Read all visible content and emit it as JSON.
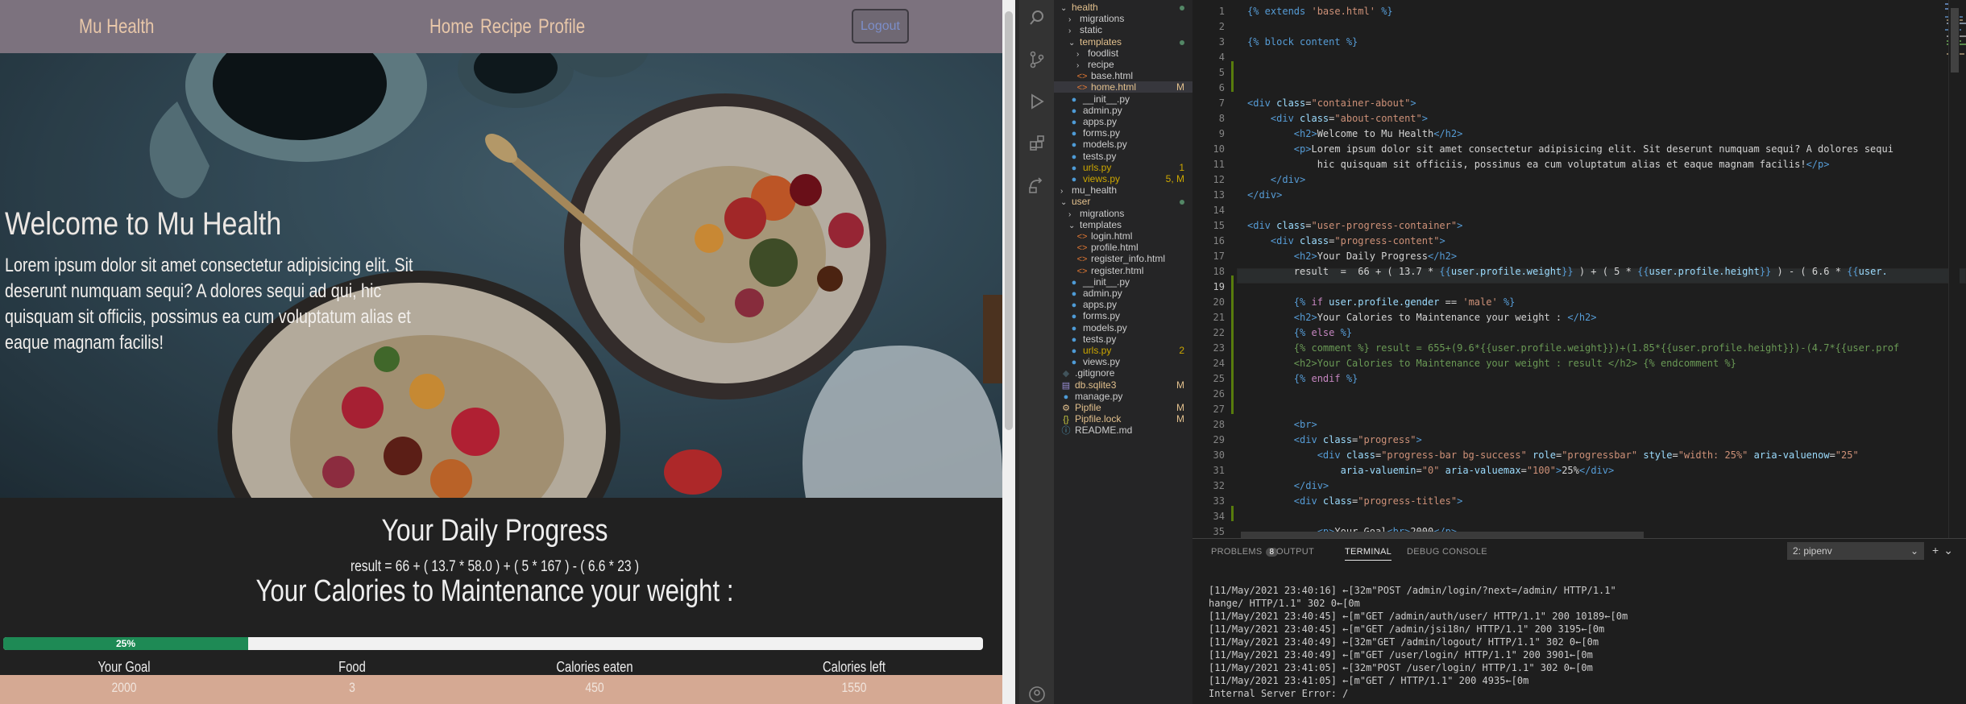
{
  "site": {
    "brand": "Mu Health",
    "nav": [
      "Home",
      "Recipe",
      "Profile"
    ],
    "nav_button": "Logout",
    "hero_title": "Welcome to Mu Health",
    "hero_text": "Lorem ipsum dolor sit amet consectetur adipisicing elit. Sit deserunt numquam sequi? A dolores sequi ad qui, hic quisquam sit officiis, possimus ea cum voluptatum alias et eaque magnam facilis!",
    "progress_title": "Your Daily Progress",
    "result_line": "result = 66 + ( 13.7 * 58.0 ) + ( 5 * 167 ) - ( 6.6 * 23 )",
    "maintenance_title": "Your Calories to Maintenance your weight :",
    "progress_label": "25%",
    "progress_value": 25,
    "columns": [
      "Your Goal",
      "Food",
      "Calories eaten",
      "Calories left"
    ],
    "values": [
      "2000",
      "3",
      "450",
      "1550"
    ]
  },
  "explorer": [
    {
      "label": "health",
      "depth": 0,
      "type": "folder-open",
      "color": "#e2c08d",
      "status": "dot"
    },
    {
      "label": "migrations",
      "depth": 1,
      "type": "folder",
      "color": "#cccccc",
      "status": ""
    },
    {
      "label": "static",
      "depth": 1,
      "type": "folder",
      "color": "#cccccc",
      "status": ""
    },
    {
      "label": "templates",
      "depth": 1,
      "type": "folder-open",
      "color": "#e2c08d",
      "status": "dot"
    },
    {
      "label": "foodlist",
      "depth": 2,
      "type": "folder",
      "color": "#cccccc",
      "status": ""
    },
    {
      "label": "recipe",
      "depth": 2,
      "type": "folder",
      "color": "#cccccc",
      "status": ""
    },
    {
      "label": "base.html",
      "depth": 2,
      "type": "html",
      "color": "#cccccc",
      "status": ""
    },
    {
      "label": "home.html",
      "depth": 2,
      "type": "html",
      "color": "#e2c08d",
      "status": "M",
      "selected": true
    },
    {
      "label": "__init__.py",
      "depth": 1,
      "type": "py",
      "color": "#cccccc",
      "status": ""
    },
    {
      "label": "admin.py",
      "depth": 1,
      "type": "py",
      "color": "#cccccc",
      "status": ""
    },
    {
      "label": "apps.py",
      "depth": 1,
      "type": "py",
      "color": "#cccccc",
      "status": ""
    },
    {
      "label": "forms.py",
      "depth": 1,
      "type": "py",
      "color": "#cccccc",
      "status": ""
    },
    {
      "label": "models.py",
      "depth": 1,
      "type": "py",
      "color": "#cccccc",
      "status": ""
    },
    {
      "label": "tests.py",
      "depth": 1,
      "type": "py",
      "color": "#cccccc",
      "status": ""
    },
    {
      "label": "urls.py",
      "depth": 1,
      "type": "py",
      "color": "#cca700",
      "status": "1"
    },
    {
      "label": "views.py",
      "depth": 1,
      "type": "py",
      "color": "#cca700",
      "status": "5, M"
    },
    {
      "label": "mu_health",
      "depth": 0,
      "type": "folder",
      "color": "#cccccc",
      "status": ""
    },
    {
      "label": "user",
      "depth": 0,
      "type": "folder-open",
      "color": "#e2c08d",
      "status": "dot"
    },
    {
      "label": "migrations",
      "depth": 1,
      "type": "folder",
      "color": "#cccccc",
      "status": ""
    },
    {
      "label": "templates",
      "depth": 1,
      "type": "folder-open",
      "color": "#cccccc",
      "status": ""
    },
    {
      "label": "login.html",
      "depth": 2,
      "type": "html",
      "color": "#cccccc",
      "status": ""
    },
    {
      "label": "profile.html",
      "depth": 2,
      "type": "html",
      "color": "#cccccc",
      "status": ""
    },
    {
      "label": "register_info.html",
      "depth": 2,
      "type": "html",
      "color": "#cccccc",
      "status": ""
    },
    {
      "label": "register.html",
      "depth": 2,
      "type": "html",
      "color": "#cccccc",
      "status": ""
    },
    {
      "label": "__init__.py",
      "depth": 1,
      "type": "py",
      "color": "#cccccc",
      "status": ""
    },
    {
      "label": "admin.py",
      "depth": 1,
      "type": "py",
      "color": "#cccccc",
      "status": ""
    },
    {
      "label": "apps.py",
      "depth": 1,
      "type": "py",
      "color": "#cccccc",
      "status": ""
    },
    {
      "label": "forms.py",
      "depth": 1,
      "type": "py",
      "color": "#cccccc",
      "status": ""
    },
    {
      "label": "models.py",
      "depth": 1,
      "type": "py",
      "color": "#cccccc",
      "status": ""
    },
    {
      "label": "tests.py",
      "depth": 1,
      "type": "py",
      "color": "#cccccc",
      "status": ""
    },
    {
      "label": "urls.py",
      "depth": 1,
      "type": "py",
      "color": "#cca700",
      "status": "2"
    },
    {
      "label": "views.py",
      "depth": 1,
      "type": "py",
      "color": "#cccccc",
      "status": ""
    },
    {
      "label": ".gitignore",
      "depth": 0,
      "type": "git",
      "color": "#cccccc",
      "status": ""
    },
    {
      "label": "db.sqlite3",
      "depth": 0,
      "type": "db",
      "color": "#e2c08d",
      "status": "M"
    },
    {
      "label": "manage.py",
      "depth": 0,
      "type": "py",
      "color": "#cccccc",
      "status": ""
    },
    {
      "label": "Pipfile",
      "depth": 0,
      "type": "pip",
      "color": "#e2c08d",
      "status": "M"
    },
    {
      "label": "Pipfile.lock",
      "depth": 0,
      "type": "json",
      "color": "#e2c08d",
      "status": "M"
    },
    {
      "label": "README.md",
      "depth": 0,
      "type": "md",
      "color": "#cccccc",
      "status": ""
    }
  ],
  "code": [
    [
      [
        "t-tmpl",
        "{% extends "
      ],
      [
        "t-str",
        "'base.html'"
      ],
      [
        "t-tmpl",
        " %}"
      ]
    ],
    [],
    [
      [
        "t-tmpl",
        "{% block content %}"
      ]
    ],
    [],
    [],
    [],
    [
      [
        "t-tag",
        "<div "
      ],
      [
        "t-attr",
        "class"
      ],
      [
        "t-txt",
        "="
      ],
      [
        "t-str",
        "\"container-about\""
      ],
      [
        "t-tag",
        ">"
      ]
    ],
    [
      [
        "t-gray",
        "    "
      ],
      [
        "t-tag",
        "<div "
      ],
      [
        "t-attr",
        "class"
      ],
      [
        "t-txt",
        "="
      ],
      [
        "t-str",
        "\"about-content\""
      ],
      [
        "t-tag",
        ">"
      ]
    ],
    [
      [
        "t-gray",
        "        "
      ],
      [
        "t-tag",
        "<h2>"
      ],
      [
        "t-txt",
        "Welcome to Mu Health"
      ],
      [
        "t-tag",
        "</h2>"
      ]
    ],
    [
      [
        "t-gray",
        "        "
      ],
      [
        "t-tag",
        "<p>"
      ],
      [
        "t-txt",
        "Lorem ipsum dolor sit amet consectetur adipisicing elit. Sit deserunt numquam sequi? A dolores sequi"
      ]
    ],
    [
      [
        "t-gray",
        "            "
      ],
      [
        "t-txt",
        "hic quisquam sit officiis, possimus ea cum voluptatum alias et eaque magnam facilis!"
      ],
      [
        "t-tag",
        "</p>"
      ]
    ],
    [
      [
        "t-gray",
        "    "
      ],
      [
        "t-tag",
        "</div>"
      ]
    ],
    [
      [
        "t-tag",
        "</div>"
      ]
    ],
    [],
    [
      [
        "t-tag",
        "<div "
      ],
      [
        "t-attr",
        "class"
      ],
      [
        "t-txt",
        "="
      ],
      [
        "t-str",
        "\"user-progress-container\""
      ],
      [
        "t-tag",
        ">"
      ]
    ],
    [
      [
        "t-gray",
        "    "
      ],
      [
        "t-tag",
        "<div "
      ],
      [
        "t-attr",
        "class"
      ],
      [
        "t-txt",
        "="
      ],
      [
        "t-str",
        "\"progress-content\""
      ],
      [
        "t-tag",
        ">"
      ]
    ],
    [
      [
        "t-gray",
        "        "
      ],
      [
        "t-tag",
        "<h2>"
      ],
      [
        "t-txt",
        "Your Daily Progress"
      ],
      [
        "t-tag",
        "</h2>"
      ]
    ],
    [
      [
        "t-gray",
        "        "
      ],
      [
        "t-txt",
        "result  =  66 + ( 13.7 * "
      ],
      [
        "t-tmpl",
        "{{"
      ],
      [
        "t-attr",
        "user.profile.weight"
      ],
      [
        "t-tmpl",
        "}}"
      ],
      [
        "t-txt",
        " ) + ( 5 * "
      ],
      [
        "t-tmpl",
        "{{"
      ],
      [
        "t-attr",
        "user.profile.height"
      ],
      [
        "t-tmpl",
        "}}"
      ],
      [
        "t-txt",
        " ) - ( 6.6 * "
      ],
      [
        "t-tmpl",
        "{{"
      ],
      [
        "t-attr",
        "user."
      ]
    ],
    [],
    [
      [
        "t-gray",
        "        "
      ],
      [
        "t-tmpl",
        "{% "
      ],
      [
        "t-kw",
        "if "
      ],
      [
        "t-attr",
        "user.profile.gender"
      ],
      [
        "t-txt",
        " == "
      ],
      [
        "t-str",
        "'male'"
      ],
      [
        "t-tmpl",
        " %}"
      ]
    ],
    [
      [
        "t-gray",
        "        "
      ],
      [
        "t-tag",
        "<h2>"
      ],
      [
        "t-txt",
        "Your Calories to Maintenance your weight : "
      ],
      [
        "t-tag",
        "</h2>"
      ]
    ],
    [
      [
        "t-gray",
        "        "
      ],
      [
        "t-tmpl",
        "{% "
      ],
      [
        "t-kw",
        "else "
      ],
      [
        "t-tmpl",
        "%}"
      ]
    ],
    [
      [
        "t-gray",
        "        "
      ],
      [
        "t-cmt",
        "{% comment %} result = 655+(9.6*{{user.profile.weight}})+(1.85*{{user.profile.height}})-(4.7*{{user.prof"
      ]
    ],
    [
      [
        "t-gray",
        "        "
      ],
      [
        "t-cmt",
        "<h2>Your Calories to Maintenance your weight : result </h2> {% endcomment %}"
      ]
    ],
    [
      [
        "t-gray",
        "        "
      ],
      [
        "t-tmpl",
        "{% "
      ],
      [
        "t-kw",
        "endif "
      ],
      [
        "t-tmpl",
        "%}"
      ]
    ],
    [],
    [],
    [
      [
        "t-gray",
        "        "
      ],
      [
        "t-tag",
        "<br>"
      ]
    ],
    [
      [
        "t-gray",
        "        "
      ],
      [
        "t-tag",
        "<div "
      ],
      [
        "t-attr",
        "class"
      ],
      [
        "t-txt",
        "="
      ],
      [
        "t-str",
        "\"progress\""
      ],
      [
        "t-tag",
        ">"
      ]
    ],
    [
      [
        "t-gray",
        "            "
      ],
      [
        "t-tag",
        "<div "
      ],
      [
        "t-attr",
        "class"
      ],
      [
        "t-txt",
        "="
      ],
      [
        "t-str",
        "\"progress-bar bg-success\""
      ],
      [
        "t-txt",
        " "
      ],
      [
        "t-attr",
        "role"
      ],
      [
        "t-txt",
        "="
      ],
      [
        "t-str",
        "\"progressbar\""
      ],
      [
        "t-txt",
        " "
      ],
      [
        "t-attr",
        "style"
      ],
      [
        "t-txt",
        "="
      ],
      [
        "t-str",
        "\"width: 25%\""
      ],
      [
        "t-txt",
        " "
      ],
      [
        "t-attr",
        "aria-valuenow"
      ],
      [
        "t-txt",
        "="
      ],
      [
        "t-str",
        "\"25\""
      ]
    ],
    [
      [
        "t-gray",
        "                "
      ],
      [
        "t-attr",
        "aria-valuemin"
      ],
      [
        "t-txt",
        "="
      ],
      [
        "t-str",
        "\"0\""
      ],
      [
        "t-txt",
        " "
      ],
      [
        "t-attr",
        "aria-valuemax"
      ],
      [
        "t-txt",
        "="
      ],
      [
        "t-str",
        "\"100\""
      ],
      [
        "t-tag",
        ">"
      ],
      [
        "t-txt",
        "25%"
      ],
      [
        "t-tag",
        "</div>"
      ]
    ],
    [
      [
        "t-gray",
        "        "
      ],
      [
        "t-tag",
        "</div>"
      ]
    ],
    [
      [
        "t-gray",
        "        "
      ],
      [
        "t-tag",
        "<div "
      ],
      [
        "t-attr",
        "class"
      ],
      [
        "t-txt",
        "="
      ],
      [
        "t-str",
        "\"progress-titles\""
      ],
      [
        "t-tag",
        ">"
      ]
    ],
    [],
    [
      [
        "t-gray",
        "            "
      ],
      [
        "t-tag",
        "<p>"
      ],
      [
        "t-txt",
        "Your Goal"
      ],
      [
        "t-tag",
        "<br>"
      ],
      [
        "t-txt",
        "2000"
      ],
      [
        "t-tag",
        "</p>"
      ]
    ]
  ],
  "panel": {
    "tabs": [
      "PROBLEMS",
      "OUTPUT",
      "TERMINAL",
      "DEBUG CONSOLE"
    ],
    "problems_count": "8",
    "active_tab": "TERMINAL",
    "terminal_select": "2: pipenv",
    "lines": [
      "[11/May/2021 23:40:16] ←[32m\"POST /admin/login/?next=/admin/ HTTP/1.1\"",
      "hange/ HTTP/1.1\" 302 0←[0m",
      "[11/May/2021 23:40:45] ←[m\"GET /admin/auth/user/ HTTP/1.1\" 200 10189←[0m",
      "[11/May/2021 23:40:45] ←[m\"GET /admin/jsi18n/ HTTP/1.1\" 200 3195←[0m",
      "[11/May/2021 23:40:49] ←[32m\"GET /admin/logout/ HTTP/1.1\" 302 0←[0m",
      "[11/May/2021 23:40:49] ←[m\"GET /user/login/ HTTP/1.1\" 200 3901←[0m",
      "[11/May/2021 23:41:05] ←[32m\"POST /user/login/ HTTP/1.1\" 302 0←[0m",
      "[11/May/2021 23:41:05] ←[m\"GET / HTTP/1.1\" 200 4935←[0m",
      "Internal Server Error: /"
    ]
  }
}
